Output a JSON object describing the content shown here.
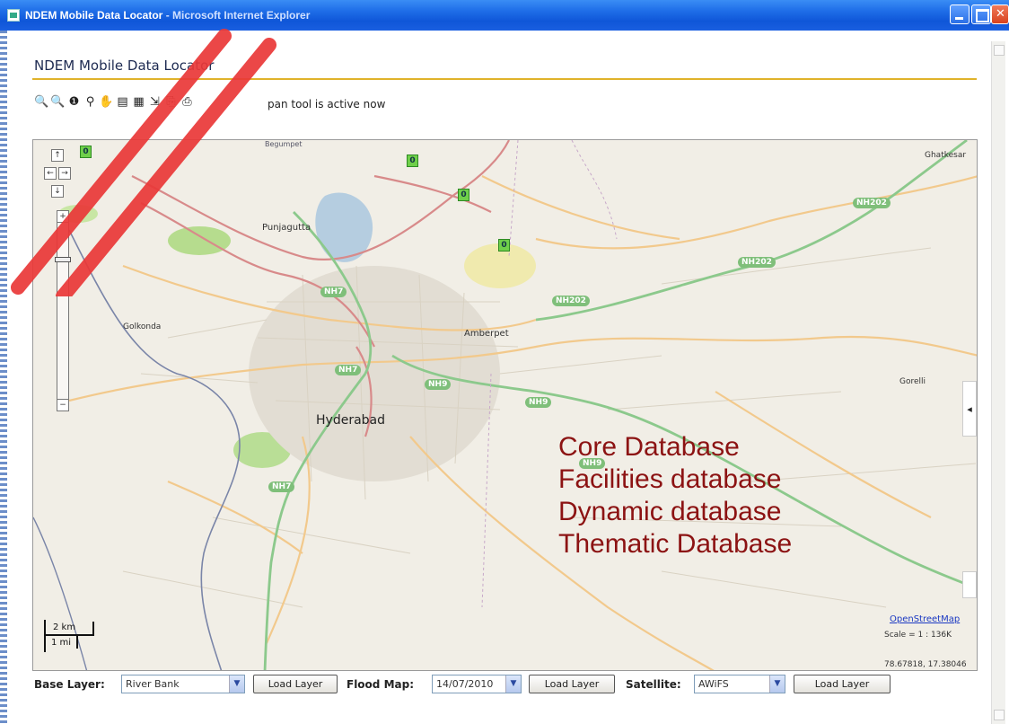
{
  "window": {
    "title": "NDEM Mobile Data Locator",
    "title_suffix": " - Microsoft Internet Explorer"
  },
  "header": {
    "page_title": "NDEM Mobile Data Locator",
    "status": "pan tool is active now"
  },
  "toolbar": {
    "icons": [
      "zoom-in-icon",
      "zoom-out-icon",
      "info-icon",
      "search-icon",
      "pan-hand-icon",
      "layers-icon",
      "layers-alt-icon",
      "select-icon",
      "export-icon",
      "print-icon"
    ]
  },
  "map": {
    "labels": {
      "ghatkesar": "Ghatkesar",
      "punjagutta": "Punjagutta",
      "golkonda": "Golkonda",
      "amberpet": "Amberpet",
      "hyderabad": "Hyderabad",
      "gorelli": "Gorelli",
      "begumpet": "Begumpet"
    },
    "roads": {
      "nh202_a": "NH202",
      "nh202_b": "NH202",
      "nh202_c": "NH202",
      "nh7_a": "NH7",
      "nh7_b": "NH7",
      "nh7_c": "NH7",
      "nh9_a": "NH9",
      "nh9_b": "NH9",
      "nh9_c": "NH9"
    },
    "poi_symbol": "0",
    "scale_km": "2 km",
    "scale_mi": "1 mi",
    "attribution": "OpenStreetMap",
    "scale_text": "Scale = 1 : 136K",
    "coords": "78.67818, 17.38046"
  },
  "overlay": {
    "lines": [
      "Core Database",
      "Facilities database",
      "Dynamic database",
      "Thematic Database"
    ]
  },
  "controls": {
    "base_layer_label": "Base Layer:",
    "base_layer_value": "River Bank",
    "flood_map_label": "Flood Map:",
    "flood_map_value": "14/07/2010",
    "satellite_label": "Satellite:",
    "satellite_value": "AWiFS",
    "load_button": "Load Layer"
  },
  "colors": {
    "titlebar": "#1f6ee8",
    "accent_rule": "#e0b32b",
    "overlay_text": "#8c1313",
    "road_green": "#7fbf7a"
  }
}
